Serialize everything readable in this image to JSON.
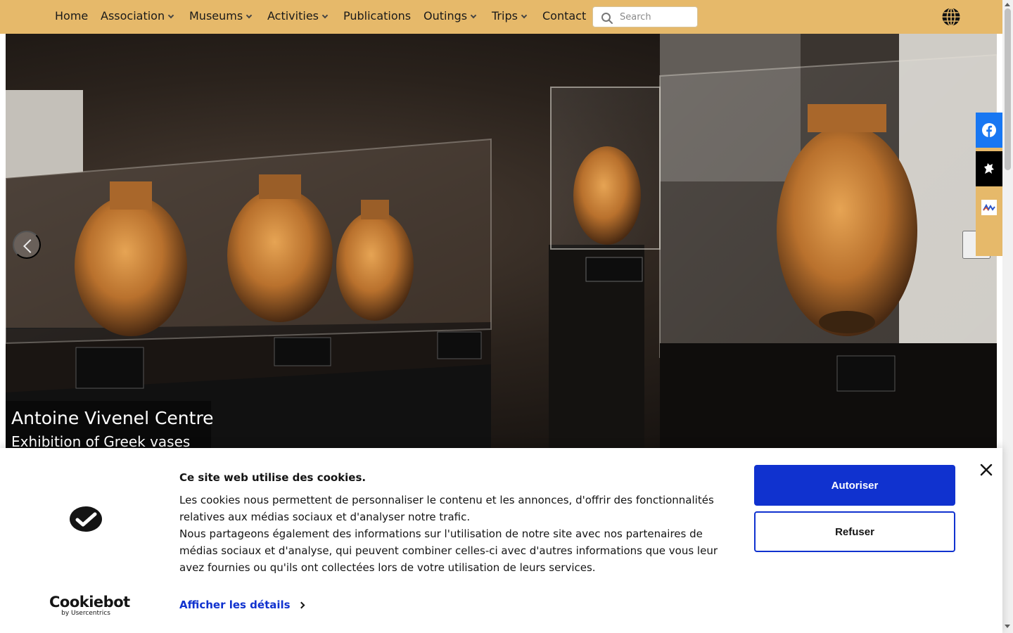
{
  "nav": {
    "items": [
      {
        "label": "Home",
        "dropdown": false
      },
      {
        "label": "Association",
        "dropdown": true
      },
      {
        "label": "Museums",
        "dropdown": true
      },
      {
        "label": "Activities",
        "dropdown": true
      },
      {
        "label": "Publications",
        "dropdown": false
      },
      {
        "label": "Outings",
        "dropdown": true
      },
      {
        "label": "Trips",
        "dropdown": true
      },
      {
        "label": "Contact",
        "dropdown": false
      }
    ],
    "search_placeholder": "Search",
    "language_icon": "globe-icon",
    "background_color": "#e6b96a"
  },
  "carousel": {
    "caption_title": "Antoine Vivenel Centre",
    "caption_subtitle": "Exhibition of Greek vases",
    "prev_icon": "chevron-left-icon",
    "next_icon": "chevron-right-icon"
  },
  "social": {
    "items": [
      {
        "icon": "facebook-icon"
      },
      {
        "icon": "compiegne-lion-icon"
      },
      {
        "icon": "partner-logo-icon"
      }
    ]
  },
  "cookie_banner": {
    "title": "Ce site web utilise des cookies.",
    "body_line1": "Les cookies nous permettent de personnaliser le contenu et les annonces, d'offrir des fonctionnalités relatives aux médias sociaux et d'analyser notre trafic.",
    "body_line2": "Nous partageons également des informations sur l'utilisation de notre site avec nos partenaires de médias sociaux et d'analyse, qui peuvent combiner celles-ci avec d'autres informations que vous leur avez fournies ou qu'ils ont collectées lors de votre utilisation de leurs services.",
    "details_link": "Afficher les détails",
    "allow_button": "Autoriser",
    "deny_button": "Refuser",
    "brand_name": "Cookiebot",
    "brand_sub": "by Usercentrics",
    "accent_color": "#1032cf"
  }
}
